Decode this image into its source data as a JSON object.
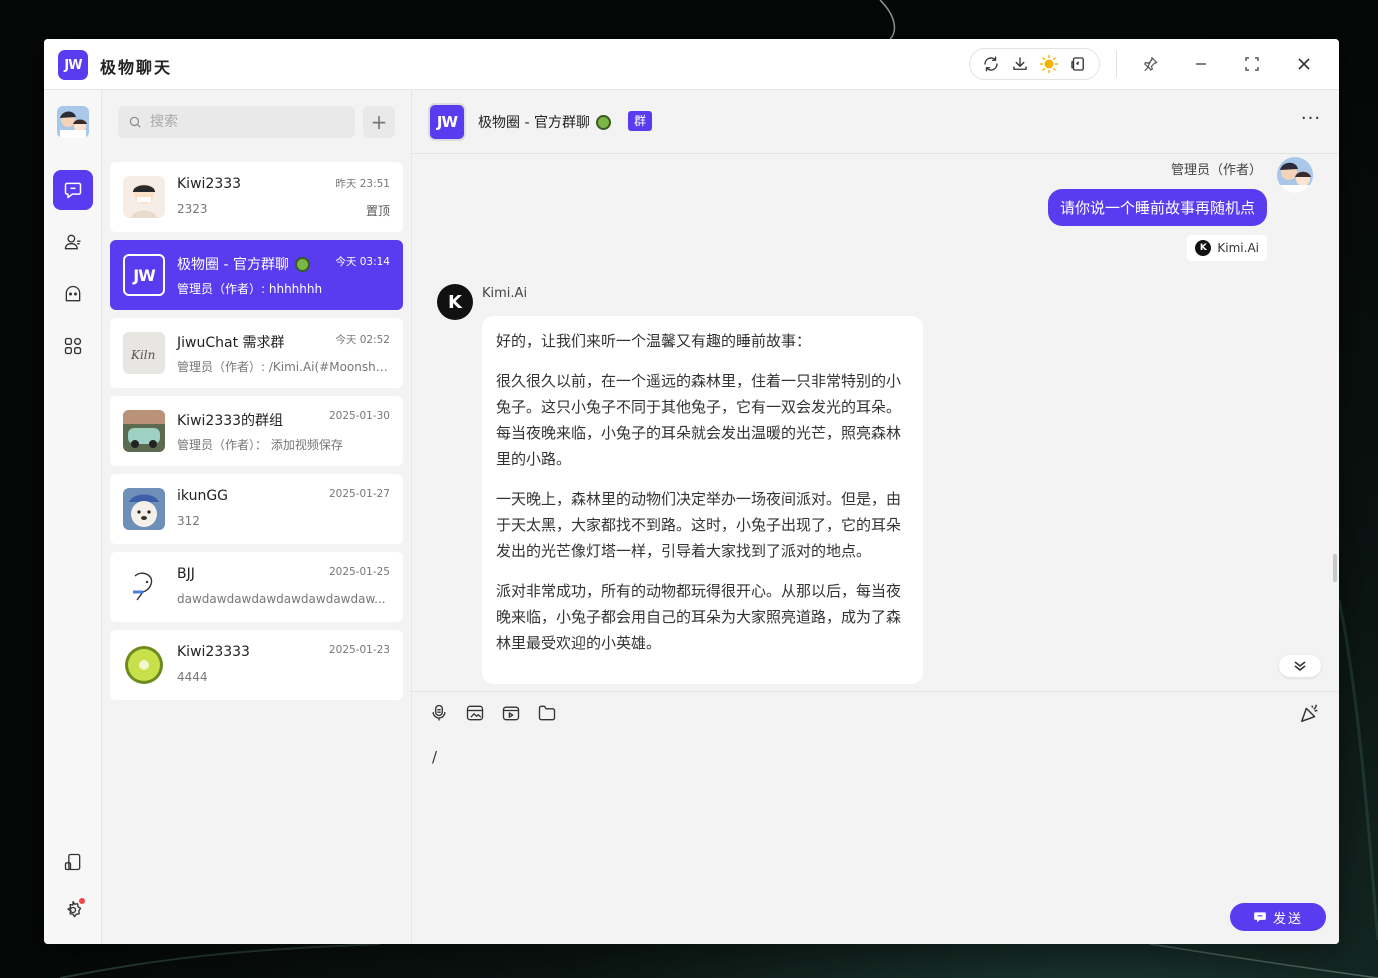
{
  "app": {
    "logo_text": "JW",
    "title": "极物聊天"
  },
  "colors": {
    "accent": "#5a3cf0",
    "window_bg": "#f3f3f3",
    "badge_red": "#f04747"
  },
  "titlebar": {
    "tools": [
      "refresh-icon",
      "download-icon",
      "sun-icon",
      "window-switch-icon"
    ],
    "window_controls": [
      "pin-icon",
      "minimize-icon",
      "maximize-icon",
      "close-icon"
    ]
  },
  "nav": {
    "items": [
      "chat-icon",
      "contacts-icon",
      "ghost-icon",
      "apps-icon"
    ],
    "bottom": [
      "layout-icon",
      "settings-icon"
    ]
  },
  "search": {
    "placeholder": "搜索",
    "add_label": "+"
  },
  "conversations": [
    {
      "name": "Kiwi2333",
      "time": "昨天 23:51",
      "preview": "2323",
      "tag": "置顶"
    },
    {
      "name": "极物圈 - 官方群聊",
      "time": "今天 03:14",
      "preview": "管理员（作者）: hhhhhhh"
    },
    {
      "name": "JiwuChat 需求群",
      "time": "今天 02:52",
      "preview": "管理员（作者）: /Kimi.Ai(#Moonshot..."
    },
    {
      "name": "Kiwi2333的群组",
      "time": "2025-01-30",
      "preview": "管理员（作者）： 添加视频保存"
    },
    {
      "name": "ikunGG",
      "time": "2025-01-27",
      "preview": "312"
    },
    {
      "name": "BJJ",
      "time": "2025-01-25",
      "preview": "dawdawdawdawdawdawdawdaw..."
    },
    {
      "name": "Kiwi23333",
      "time": "2025-01-23",
      "preview": "4444"
    }
  ],
  "chat": {
    "logo_text": "JW",
    "title": "极物圈 - 官方群聊",
    "badge": "群",
    "more": "···",
    "me": {
      "sender": "管理员（作者）",
      "message": "请你说一个睡前故事再随机点",
      "ref": "Kimi.Ai"
    },
    "bot": {
      "sender": "Kimi.Ai",
      "avatar_text": "K",
      "paragraphs": [
        "好的，让我们来听一个温馨又有趣的睡前故事：",
        "很久很久以前，在一个遥远的森林里，住着一只非常特别的小兔子。这只小兔子不同于其他兔子，它有一双会发光的耳朵。每当夜晚来临，小兔子的耳朵就会发出温暖的光芒，照亮森林里的小路。",
        "一天晚上，森林里的动物们决定举办一场夜间派对。但是，由于天太黑，大家都找不到路。这时，小兔子出现了，它的耳朵发出的光芒像灯塔一样，引导着大家找到了派对的地点。",
        "派对非常成功，所有的动物都玩得很开心。从那以后，每当夜晚来临，小兔子都会用自己的耳朵为大家照亮道路，成为了森林里最受欢迎的小英雄。"
      ]
    }
  },
  "composer": {
    "value": "/",
    "tools": [
      "microphone-icon",
      "image-icon",
      "video-icon",
      "folder-icon"
    ],
    "send_label": "发送"
  }
}
